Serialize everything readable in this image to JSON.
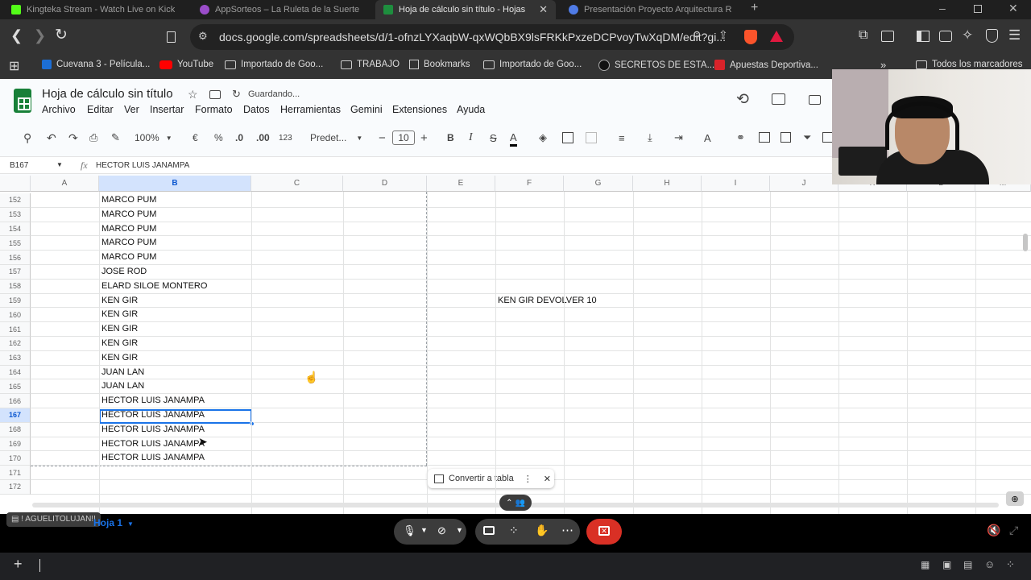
{
  "browser": {
    "tabs": [
      {
        "title": "Kingteka Stream - Watch Live on Kick",
        "fav_color": "#53fc18"
      },
      {
        "title": "AppSorteos – La Ruleta de la Suerte",
        "fav_color": "#9b4dca"
      },
      {
        "title": "Hoja de cálculo sin título - Hojas",
        "fav_color": "#1e8e3e"
      },
      {
        "title": "Presentación Proyecto Arquitectura R",
        "fav_color": "#4f7be6"
      }
    ],
    "url": "docs.google.com/spreadsheets/d/1-ofnzLYXaqbW-qxWQbBX9lsFRKkPxzeDCPvoyTwXqDM/edit?gi...",
    "bookmarks": [
      "Cuevana 3 - Película...",
      "YouTube",
      "Importado de Goo...",
      "TRABAJO",
      "Bookmarks",
      "Importado de Goo...",
      "SECRETOS DE ESTA...",
      "Apuestas Deportiva..."
    ],
    "all_bookmarks": "Todos los marcadores"
  },
  "sheet": {
    "title": "Hoja de cálculo sin título",
    "saving": "Guardando...",
    "menus": [
      "Archivo",
      "Editar",
      "Ver",
      "Insertar",
      "Formato",
      "Datos",
      "Herramientas",
      "Gemini",
      "Extensiones",
      "Ayuda"
    ],
    "zoom": "100%",
    "currency": "€",
    "percent": "%",
    "dec_less": ".0",
    "dec_more": ".00",
    "num_format": "123",
    "font": "Predet...",
    "font_size": "10",
    "cell_ref": "B167",
    "formula": "HECTOR LUIS JANAMPA",
    "columns": [
      "A",
      "B",
      "C",
      "D",
      "E",
      "F",
      "G",
      "H",
      "I",
      "J",
      "K",
      "L",
      "M"
    ],
    "rows": [
      {
        "n": "152",
        "b": "MARCO PUM"
      },
      {
        "n": "153",
        "b": "MARCO PUM"
      },
      {
        "n": "154",
        "b": "MARCO PUM"
      },
      {
        "n": "155",
        "b": "MARCO PUM"
      },
      {
        "n": "156",
        "b": "MARCO PUM"
      },
      {
        "n": "157",
        "b": "JOSE ROD"
      },
      {
        "n": "158",
        "b": "ELARD SILOE MONTERO"
      },
      {
        "n": "159",
        "b": "KEN GIR",
        "f": "KEN GIR DEVOLVER 10"
      },
      {
        "n": "160",
        "b": "KEN GIR"
      },
      {
        "n": "161",
        "b": "KEN GIR"
      },
      {
        "n": "162",
        "b": "KEN GIR"
      },
      {
        "n": "163",
        "b": "KEN GIR"
      },
      {
        "n": "164",
        "b": "JUAN LAN"
      },
      {
        "n": "165",
        "b": "JUAN LAN"
      },
      {
        "n": "166",
        "b": "HECTOR LUIS JANAMPA"
      },
      {
        "n": "167",
        "b": "HECTOR LUIS JANAMPA"
      },
      {
        "n": "168",
        "b": "HECTOR LUIS JANAMPA"
      },
      {
        "n": "169",
        "b": "HECTOR LUIS JANAMPA"
      },
      {
        "n": "170",
        "b": "HECTOR LUIS JANAMPA"
      },
      {
        "n": "171",
        "b": ""
      },
      {
        "n": "172",
        "b": ""
      }
    ],
    "convert_table": "Convertir a tabla",
    "sheet_tab": "Hoja 1"
  },
  "overlay": {
    "chat_user": "! AGUELITOLUJAN!!"
  },
  "colors": {
    "accent": "#1a73e8",
    "end_call": "#d93025"
  }
}
